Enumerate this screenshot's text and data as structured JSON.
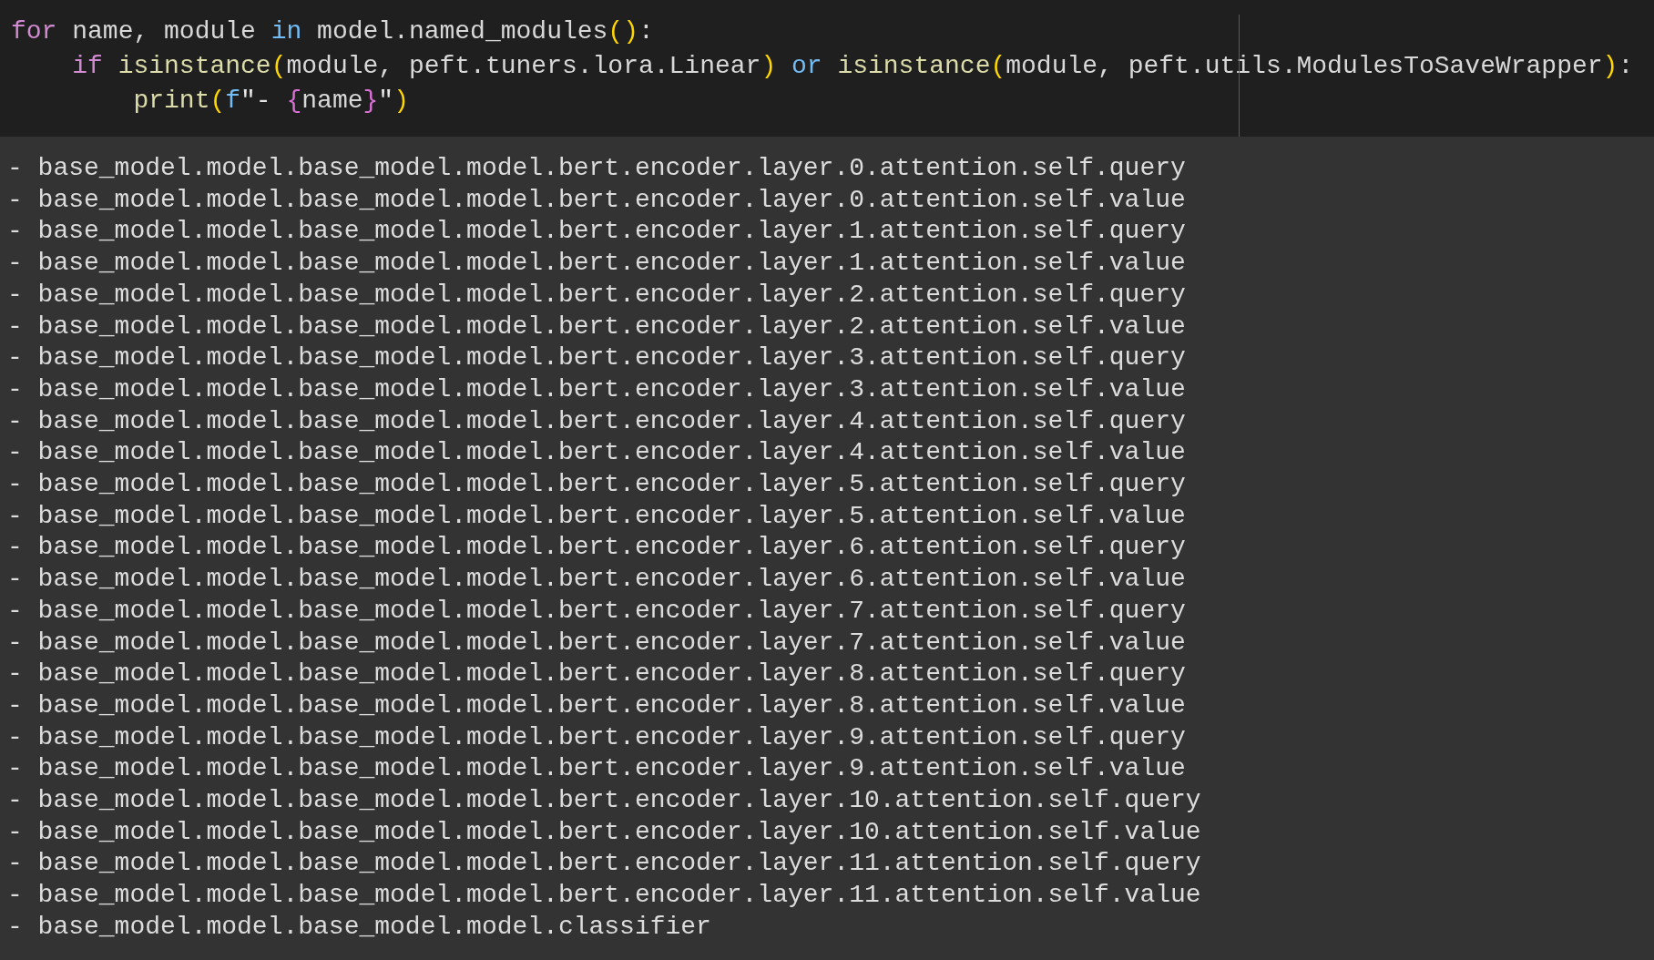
{
  "code": {
    "lines": [
      [
        {
          "text": "for",
          "kind": "keyword"
        },
        {
          "text": " name, module ",
          "kind": "plain"
        },
        {
          "text": "in",
          "kind": "operator"
        },
        {
          "text": " model.named_modules",
          "kind": "plain"
        },
        {
          "text": "()",
          "kind": "paren"
        },
        {
          "text": ":",
          "kind": "plain"
        }
      ],
      [
        {
          "text": "    if",
          "kind": "keyword"
        },
        {
          "text": " isinstance",
          "kind": "function"
        },
        {
          "text": "(",
          "kind": "paren"
        },
        {
          "text": "module, peft.tuners.lora.Linear",
          "kind": "plain"
        },
        {
          "text": ")",
          "kind": "paren"
        },
        {
          "text": " or",
          "kind": "operator"
        },
        {
          "text": " isinstance",
          "kind": "function"
        },
        {
          "text": "(",
          "kind": "paren"
        },
        {
          "text": "module, peft.utils.ModulesToSaveWrapper",
          "kind": "plain"
        },
        {
          "text": ")",
          "kind": "paren"
        },
        {
          "text": ":",
          "kind": "plain"
        }
      ],
      [
        {
          "text": "        print",
          "kind": "function"
        },
        {
          "text": "(",
          "kind": "paren"
        },
        {
          "text": "f",
          "kind": "operator"
        },
        {
          "text": "\"- ",
          "kind": "string"
        },
        {
          "text": "{",
          "kind": "brace"
        },
        {
          "text": "name",
          "kind": "plain"
        },
        {
          "text": "}",
          "kind": "brace"
        },
        {
          "text": "\"",
          "kind": "string"
        },
        {
          "text": ")",
          "kind": "paren"
        }
      ]
    ]
  },
  "output": {
    "lines": [
      "- base_model.model.base_model.model.bert.encoder.layer.0.attention.self.query",
      "- base_model.model.base_model.model.bert.encoder.layer.0.attention.self.value",
      "- base_model.model.base_model.model.bert.encoder.layer.1.attention.self.query",
      "- base_model.model.base_model.model.bert.encoder.layer.1.attention.self.value",
      "- base_model.model.base_model.model.bert.encoder.layer.2.attention.self.query",
      "- base_model.model.base_model.model.bert.encoder.layer.2.attention.self.value",
      "- base_model.model.base_model.model.bert.encoder.layer.3.attention.self.query",
      "- base_model.model.base_model.model.bert.encoder.layer.3.attention.self.value",
      "- base_model.model.base_model.model.bert.encoder.layer.4.attention.self.query",
      "- base_model.model.base_model.model.bert.encoder.layer.4.attention.self.value",
      "- base_model.model.base_model.model.bert.encoder.layer.5.attention.self.query",
      "- base_model.model.base_model.model.bert.encoder.layer.5.attention.self.value",
      "- base_model.model.base_model.model.bert.encoder.layer.6.attention.self.query",
      "- base_model.model.base_model.model.bert.encoder.layer.6.attention.self.value",
      "- base_model.model.base_model.model.bert.encoder.layer.7.attention.self.query",
      "- base_model.model.base_model.model.bert.encoder.layer.7.attention.self.value",
      "- base_model.model.base_model.model.bert.encoder.layer.8.attention.self.query",
      "- base_model.model.base_model.model.bert.encoder.layer.8.attention.self.value",
      "- base_model.model.base_model.model.bert.encoder.layer.9.attention.self.query",
      "- base_model.model.base_model.model.bert.encoder.layer.9.attention.self.value",
      "- base_model.model.base_model.model.bert.encoder.layer.10.attention.self.query",
      "- base_model.model.base_model.model.bert.encoder.layer.10.attention.self.value",
      "- base_model.model.base_model.model.bert.encoder.layer.11.attention.self.query",
      "- base_model.model.base_model.model.bert.encoder.layer.11.attention.self.value",
      "- base_model.model.base_model.model.classifier"
    ]
  }
}
